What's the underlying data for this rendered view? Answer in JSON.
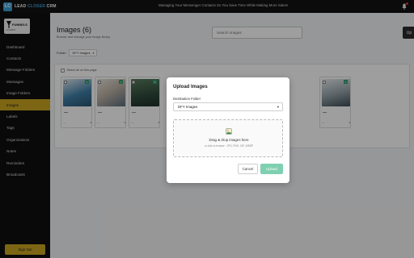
{
  "app": {
    "logo_badge": "LC",
    "logo_text_white": "LEAD",
    "logo_text_blue": "CLOSER",
    "logo_text_tail": "CRM",
    "banner": "Managing Your Messenger Contacts So You Save Time While Making More Sales!"
  },
  "brand": {
    "name": "FUNNELS",
    "sub": "& LEADS"
  },
  "sidebar": {
    "items": [
      {
        "label": "Dashboard",
        "active": false
      },
      {
        "label": "Contacts",
        "active": false
      },
      {
        "label": "Message Folders",
        "active": false
      },
      {
        "label": "Messages",
        "active": false
      },
      {
        "label": "Image Folders",
        "active": false
      },
      {
        "label": "Images",
        "active": true
      },
      {
        "label": "Labels",
        "active": false
      },
      {
        "label": "Tags",
        "active": false
      },
      {
        "label": "Organizations",
        "active": false
      },
      {
        "label": "Notes",
        "active": false
      },
      {
        "label": "Reminders",
        "active": false
      },
      {
        "label": "Broadcasts",
        "active": false
      }
    ],
    "sign_out": "Sign Out"
  },
  "main": {
    "title": "Images (6)",
    "subtitle": "Browse and manage your image library",
    "search_placeholder": "Search images",
    "upload_button": "Up",
    "folder_label": "Folder:",
    "folder_value": "DFY Images",
    "select_all": "Select all on this page"
  },
  "modal": {
    "title": "Upload Images",
    "field_label": "Destination Folder",
    "folder_value": "DFY Images",
    "drop_title": "Drag & drop images here",
    "drop_hint": "or click to browse · JPG, PNG, GIF, WEBP",
    "cancel": "Cancel",
    "upload": "Upload"
  },
  "colors": {
    "accent_gold": "#c9a521",
    "brand_blue": "#3aa0d8",
    "success_green": "#7fd0b0"
  }
}
